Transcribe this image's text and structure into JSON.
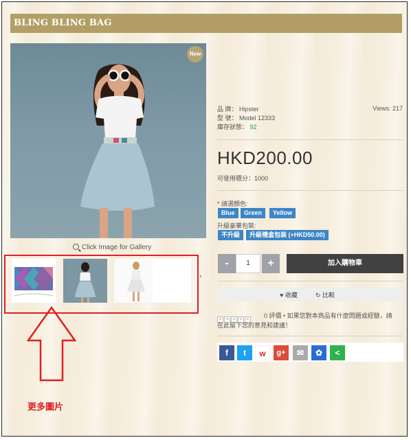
{
  "header": {
    "title": "BLING BLING BAG"
  },
  "gallery": {
    "badge": "New",
    "zoom_hint": "Click Image for Gallery",
    "next_glyph": "›"
  },
  "annotation": {
    "caption": "更多圖片",
    "color": "#e02020"
  },
  "product": {
    "brand_label": "品 牌：",
    "brand_value": "Hipster",
    "model_label": "型 號：",
    "model_value": "Model 12333",
    "stock_label": "庫存狀態：",
    "stock_value": "92",
    "views": "Views: 217",
    "price": "HKD200.00",
    "points": "可使用積分：1000"
  },
  "options": {
    "color_label": "請選顏色:",
    "colors": [
      "Blue",
      "Green",
      "Yellow"
    ],
    "upgrade_label": "升級豪華包裝:",
    "upgrades": [
      "不升級",
      "升級禮盒包装 (+HKD50.00)"
    ]
  },
  "cart": {
    "minus": "-",
    "qty": "1",
    "plus": "+",
    "add_label": "加入購物車"
  },
  "actions": {
    "wishlist": "收藏",
    "compare": "比較"
  },
  "reviews": {
    "text": "0 評價 • 如果您對本商品有什麼問題或經驗，請",
    "text2": "在此留下您的意見和建議！"
  },
  "share": {
    "icons": [
      "facebook-icon",
      "twitter-icon",
      "weibo-icon",
      "google-plus-icon",
      "email-icon",
      "baidu-icon",
      "share-icon"
    ],
    "glyphs": [
      "f",
      "t",
      "w",
      "g+",
      "✉",
      "✿",
      "<"
    ],
    "colors": [
      "#3b5998",
      "#1da1f2",
      "#ffffff",
      "#dd4b39",
      "#aaaaaa",
      "#2b6cd4",
      "#2eb24c"
    ]
  },
  "theme": {
    "accent": "#b39f66",
    "button_blue": "#3d85c6",
    "cart_dark": "#414141"
  }
}
